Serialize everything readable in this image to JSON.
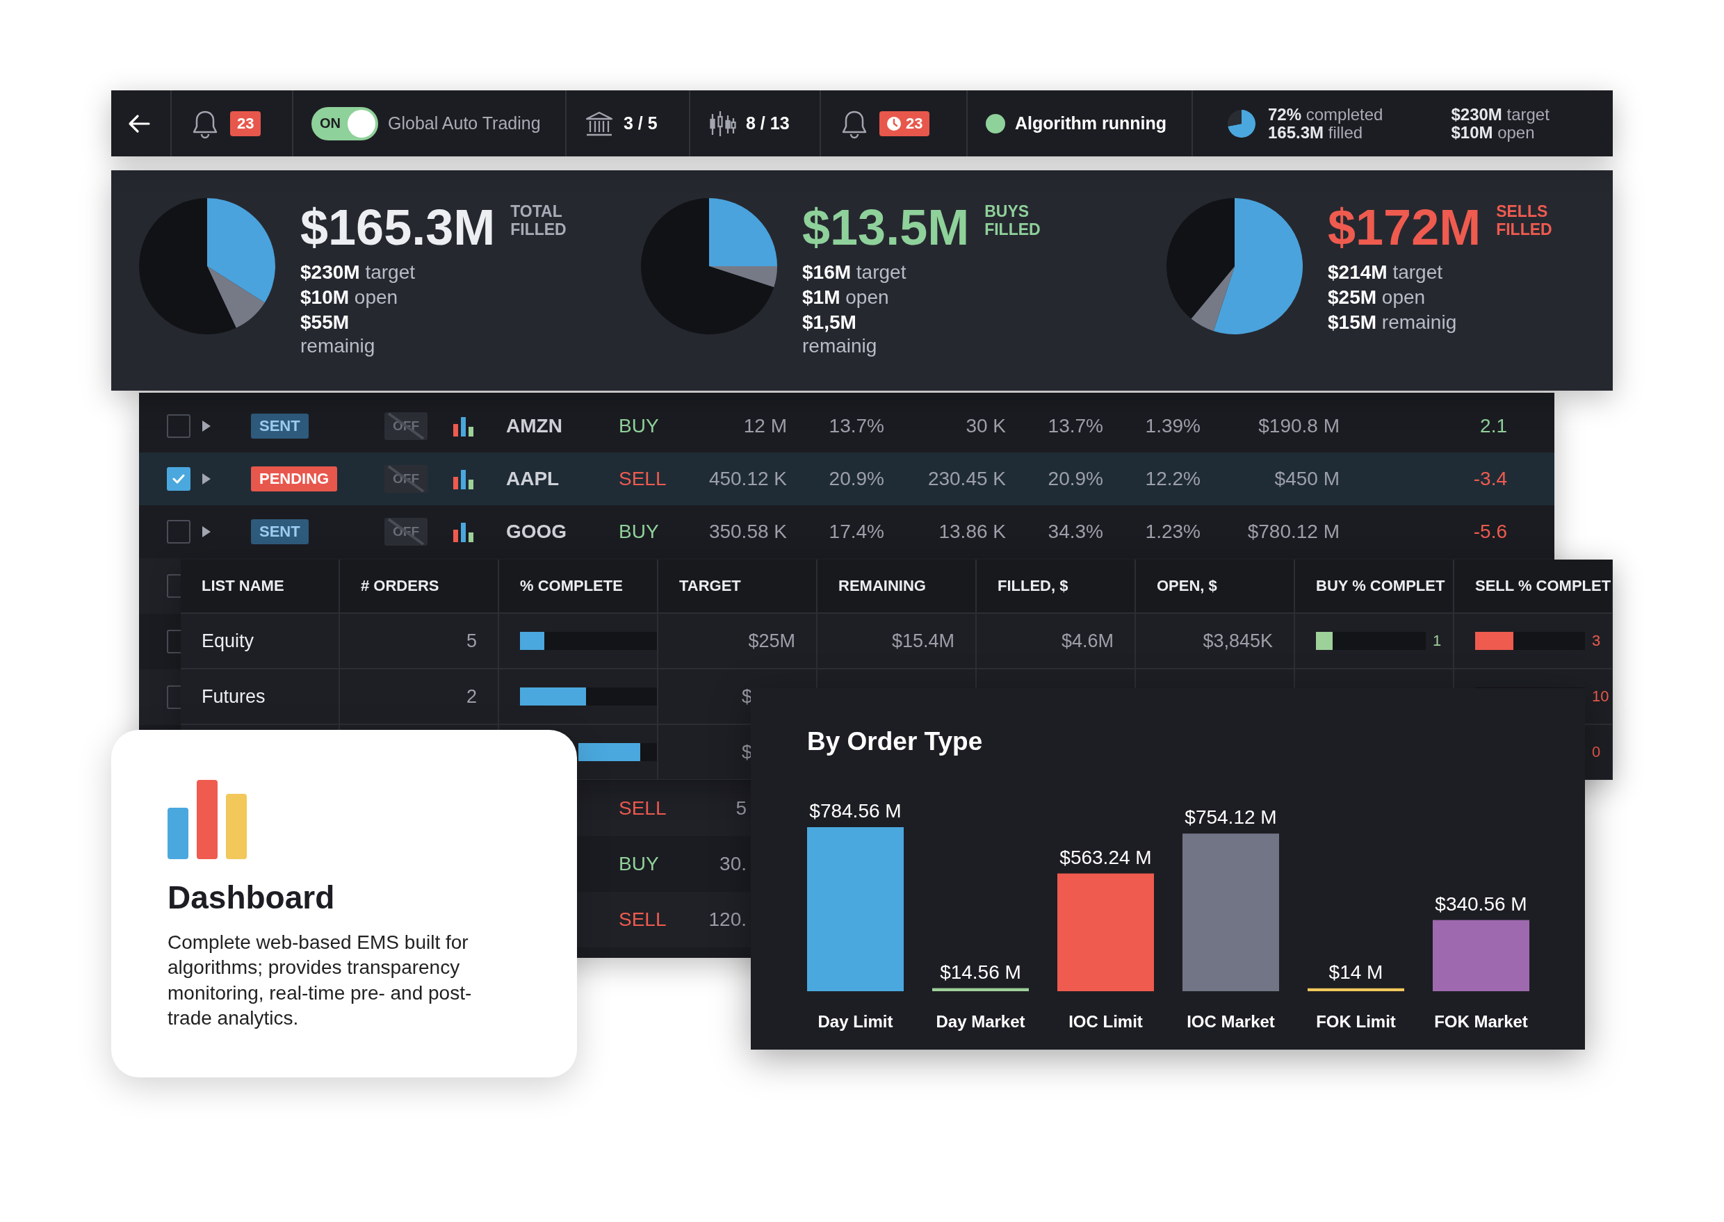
{
  "top_bar": {
    "notifications": {
      "count": "23"
    },
    "auto_trading": {
      "state_label": "ON",
      "on": true,
      "label": "Global Auto Trading"
    },
    "accounts": {
      "value": "3 / 5"
    },
    "strategies": {
      "value": "8 / 13"
    },
    "alerts": {
      "count": "23"
    },
    "algorithm": {
      "text": "Algorithm running",
      "running": true
    },
    "progress": {
      "level": 0.72,
      "completed": "**72%** completed",
      "filled": "**165.3M** filled"
    },
    "totals": [
      "**$230M** target",
      "**$10M** open"
    ]
  },
  "summary": [
    {
      "kind": "total",
      "amount": "$165.3M",
      "label": "TOTAL FILLED",
      "lines": [
        "**$230M** target",
        "**$10M** open",
        "**$55M** remainig"
      ]
    },
    {
      "kind": "buys",
      "amount": "$13.5M",
      "label": "BUYS FILLED",
      "lines": [
        "**$16M** target",
        "**$1M** open",
        "**$1,5M** remainig"
      ]
    },
    {
      "kind": "sells",
      "amount": "$172M",
      "label": "SELLS FILLED",
      "lines": [
        "**$214M** target",
        "**$25M** open",
        "**$15M** remainig"
      ]
    }
  ],
  "orders": {
    "rows": [
      {
        "checked": false,
        "selected": false,
        "status": {
          "text": "SENT",
          "kind": "sent"
        },
        "algo": "OFF",
        "symbol": "AMZN",
        "side": {
          "text": "BUY",
          "kind": "buy"
        },
        "cells": [
          "12 M",
          "13.7%",
          "30 K",
          "13.7%",
          "1.39%",
          "$190.8 M"
        ],
        "change": {
          "text": "2.1",
          "kind": "gain"
        }
      },
      {
        "checked": true,
        "selected": true,
        "status": {
          "text": "PENDING",
          "kind": "pending"
        },
        "algo": "OFF",
        "symbol": "AAPL",
        "side": {
          "text": "SELL",
          "kind": "sell"
        },
        "cells": [
          "450.12 K",
          "20.9%",
          "230.45 K",
          "20.9%",
          "12.2%",
          "$450 M"
        ],
        "change": {
          "text": "-3.4",
          "kind": "loss"
        }
      },
      {
        "checked": false,
        "selected": false,
        "status": {
          "text": "SENT",
          "kind": "sent"
        },
        "algo": "OFF",
        "symbol": "GOOG",
        "side": {
          "text": "BUY",
          "kind": "buy"
        },
        "cells": [
          "350.58 K",
          "17.4%",
          "13.86 K",
          "34.3%",
          "1.23%",
          "$780.12 M"
        ],
        "change": {
          "text": "-5.6",
          "kind": "loss"
        }
      }
    ],
    "covered_rows": [
      {
        "checked": false
      },
      {
        "checked": false
      },
      {
        "checked": false
      }
    ],
    "lower_rows": [
      {
        "side": {
          "text": "SELL",
          "kind": "sell"
        },
        "quantity": "5"
      },
      {
        "side": {
          "text": "BUY",
          "kind": "buy"
        },
        "quantity": "30."
      },
      {
        "side": {
          "text": "SELL",
          "kind": "sell"
        },
        "quantity": "120."
      }
    ]
  },
  "list_table": {
    "columns": [
      "LIST NAME",
      "# ORDERS",
      "% COMPLETE",
      "TARGET",
      "REMAINING",
      "FILLED, $",
      "OPEN, $",
      "BUY % COMPLET",
      "SELL % COMPLET"
    ],
    "rows": [
      {
        "name": "Equity",
        "orders": "5",
        "complete": {
          "level": 0.18
        },
        "target": "$25M",
        "remaining": "$15.4M",
        "filled": "$4.6M",
        "open": "$3,845K",
        "buy": {
          "level": 0.15,
          "value": "1"
        },
        "sell": {
          "level": 0.35,
          "value": "3"
        }
      },
      {
        "name": "Futures",
        "orders": "2",
        "complete": {
          "level": 0.48
        },
        "target": "$",
        "sell": {
          "value": "10"
        }
      },
      {
        "target": "$",
        "sell": {
          "value": "0"
        }
      }
    ]
  },
  "card": {
    "title": "Dashboard",
    "description": "Complete web-based EMS built for algorithms; provides transparency monitoring, real-time pre- and post-trade analytics."
  },
  "order_type_chart": {
    "title": "By Order Type",
    "chart_data": {
      "type": "bar",
      "categories": [
        "Day Limit",
        "Day Market",
        "IOC Limit",
        "IOC Market",
        "FOK Limit",
        "FOK Market"
      ],
      "values": [
        784.56,
        14.56,
        563.24,
        754.12,
        14,
        340.56
      ],
      "value_labels": [
        "$784.56 M",
        "$14.56 M",
        "$563.24 M",
        "$754.12 M",
        "$14 M",
        "$340.56 M"
      ],
      "colors": [
        "#4aa8de",
        "#9ed09a",
        "#ef5b4f",
        "#717585",
        "#f2c85b",
        "#9e69ae"
      ]
    }
  }
}
